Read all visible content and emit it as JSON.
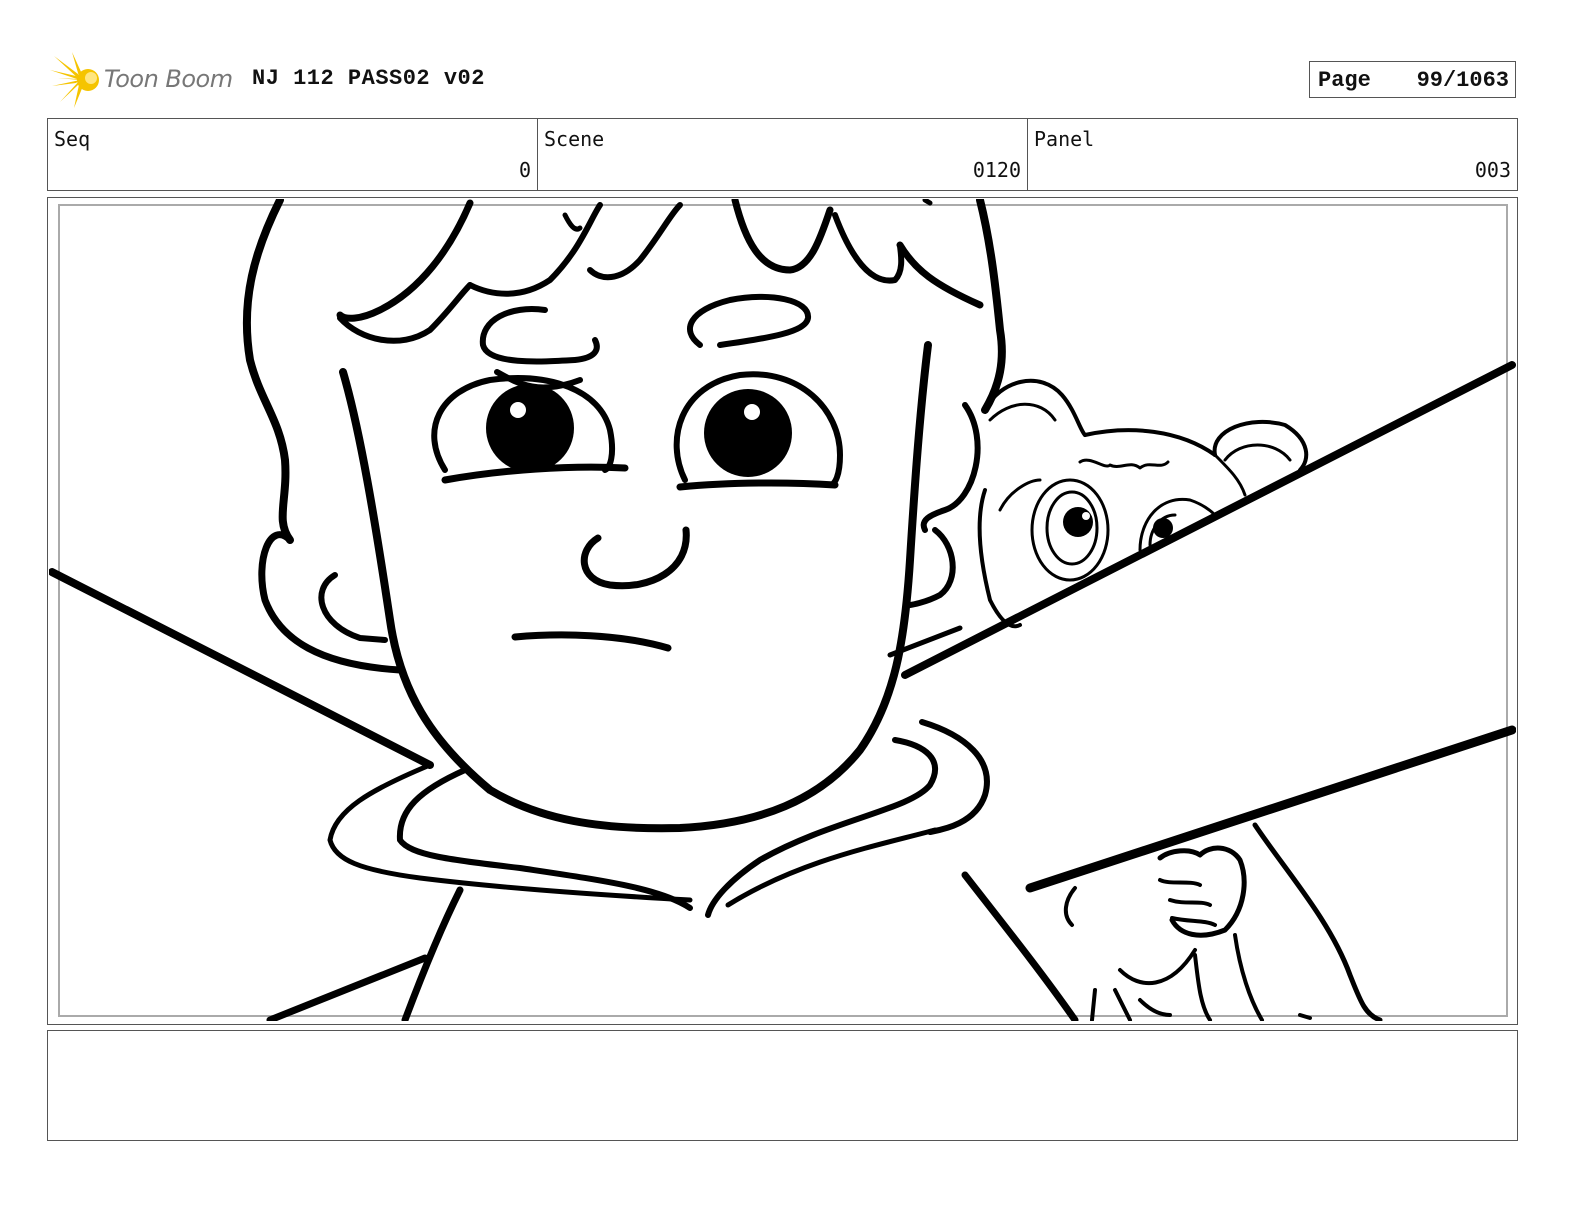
{
  "header": {
    "logo_text": "Toon Boom",
    "logo_icon": "sunburst-icon",
    "title": "NJ 112 PASS02 v02",
    "page_label": "Page",
    "page_value": "99/1063"
  },
  "fields": {
    "seq_label": "Seq",
    "seq_value": "0",
    "scene_label": "Scene",
    "scene_value": "0120",
    "panel_label": "Panel",
    "panel_value": "003"
  },
  "notes": {
    "text": ""
  },
  "colors": {
    "logo_accent": "#f5c400",
    "border": "#555555",
    "sketch_ink": "#000000"
  }
}
